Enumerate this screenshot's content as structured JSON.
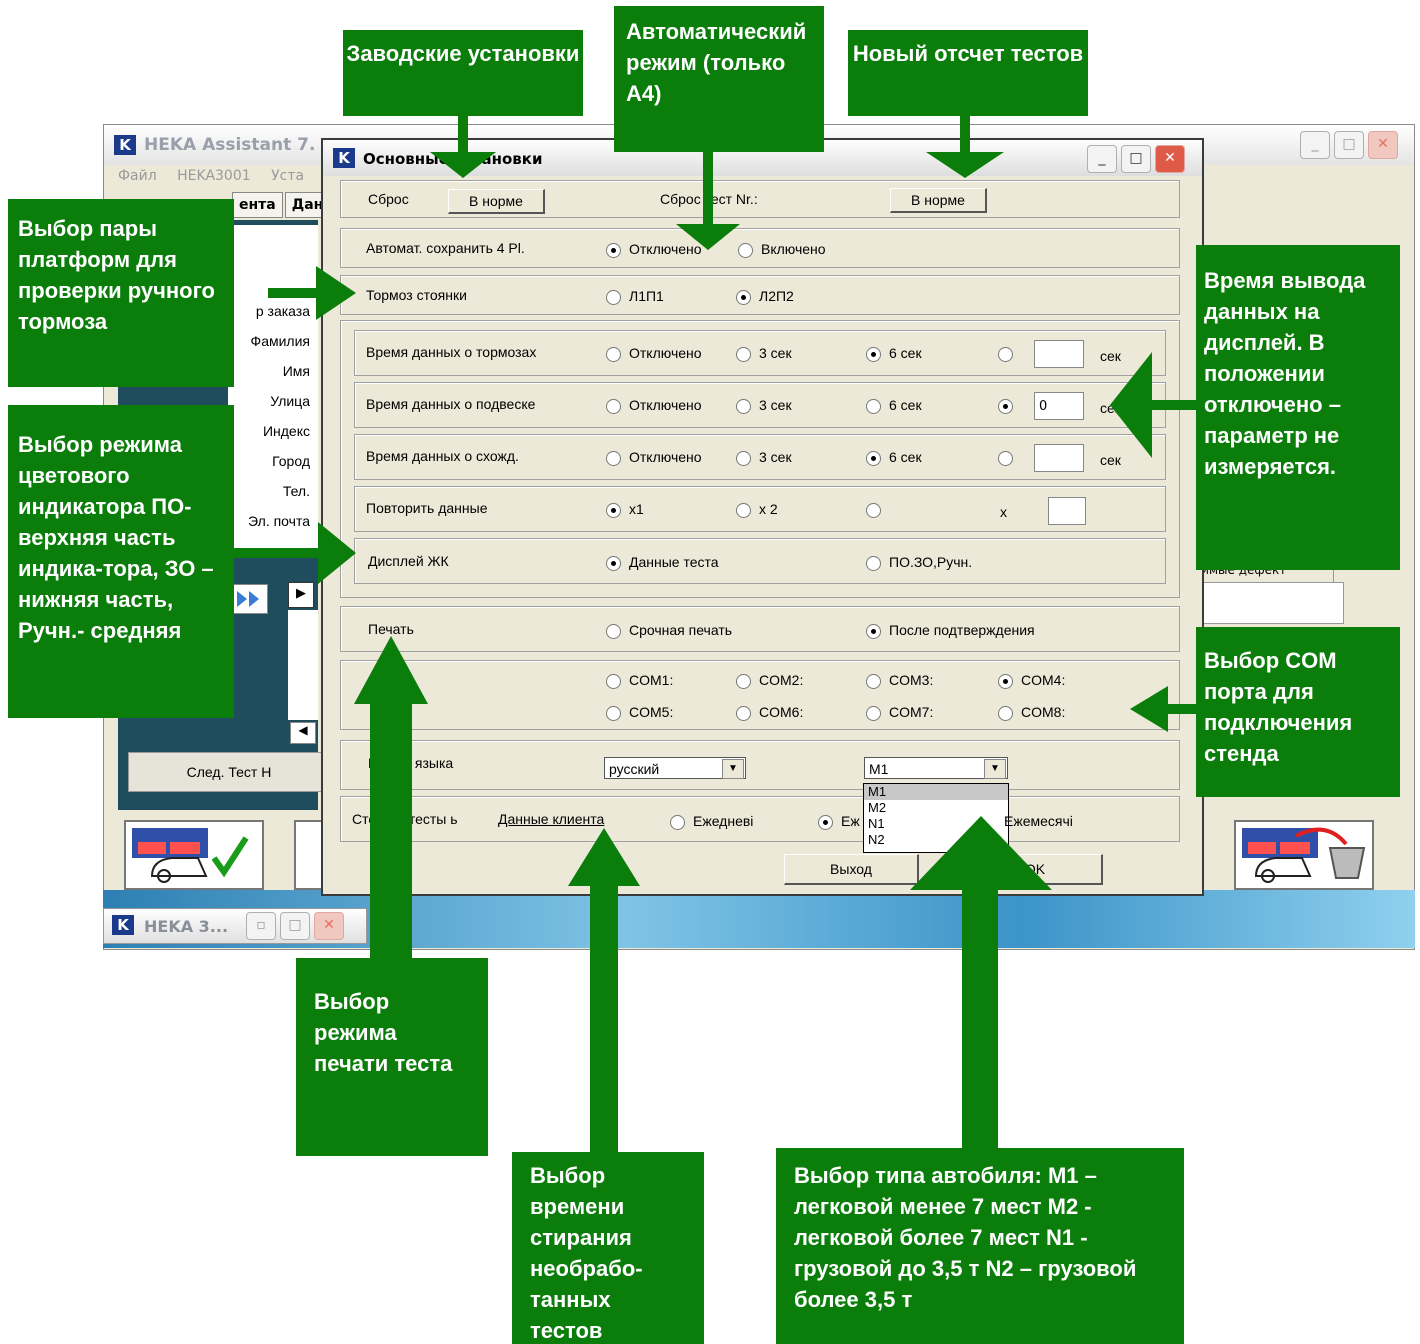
{
  "background_app": {
    "title": "HEKA Assistant 7.",
    "menu": [
      "Файл",
      "HEKA3001",
      "Уста"
    ],
    "tabs": [
      "ента",
      "Дан"
    ],
    "fields": [
      "р заказа",
      "Фамилия",
      "Имя",
      "Улица",
      "Индекс",
      "Город",
      "Тел.",
      "Эл. почта"
    ],
    "next_test_label": "След. Тест H",
    "right_tab_label": "цимые дефект",
    "minimized_title": "HEKA 3..."
  },
  "dialog": {
    "title": "Основные установки",
    "reset_label": "Сброс",
    "reset_button": "В норме",
    "reset_test_label": "Сброс тест Nr.:",
    "reset_test_button": "В норме",
    "autosave_label": "Автомат. сохранить 4 Pl.",
    "autosave_off": "Отключено",
    "autosave_on": "Включено",
    "parking_label": "Тормоз стоянки",
    "parking_opt1": "Л1П1",
    "parking_opt2": "Л2П2",
    "brakes_label": "Время данных о тормозах",
    "suspension_label": "Время данных о подвеске",
    "alignment_label": "Время данных о схожд.",
    "opt_off": "Отключено",
    "opt_3": "3 сек",
    "opt_6": "6 сек",
    "unit_sec": "сек",
    "suspension_value": "0",
    "repeat_label": "Повторить данные",
    "repeat_x1": "x1",
    "repeat_x2": "x 2",
    "repeat_x": "x",
    "lcd_label": "Дисплей ЖК",
    "lcd_opt1": "Данные теста",
    "lcd_opt2": "ПО.ЗО,Ручн.",
    "print_label": "Печать",
    "print_opt1": "Срочная печать",
    "print_opt2": "После подтверждения",
    "com_ports": [
      "COM1:",
      "COM2:",
      "COM3:",
      "COM4:",
      "COM5:",
      "COM6:",
      "COM7:",
      "COM8:"
    ],
    "language_label": "Выбор языка",
    "language_value": "русский",
    "vehicle_value": "M1",
    "vehicle_options": [
      "M1",
      "M2",
      "N1",
      "N2"
    ],
    "erase_label": "Стереть тесты ь",
    "erase_link": "Данные клиента",
    "erase_daily": "Ежедневі",
    "erase_weekly": "Еж",
    "erase_monthly": "Ежемесячі",
    "exit_button": "Выход",
    "ok_button": "OK"
  },
  "annotations": {
    "factory": "Заводские установки",
    "auto_mode": "Автоматический режим (только А4)",
    "new_count": "Новый отсчет тестов",
    "parking_pair": "Выбор пары платформ для проверки ручного тормоза",
    "display_time": "Время вывода данных на дисплей. В положении отключено – параметр не измеряется.",
    "color_indicator": "Выбор режима цветового индикатора ПО-верхняя часть индика-тора, ЗО – нижняя часть, Ручн.- средняя",
    "com_port": "Выбор COM порта для подключения стенда",
    "print_mode": "Выбор режима печати теста",
    "erase_time": "Выбор времени стирания необрабо-танных тестов",
    "vehicle_type": "Выбор типа автобиля: M1 – легковой менее 7 мест M2 - легковой более 7 мест N1 - грузовой до 3,5 т N2 – грузовой более 3,5 т"
  },
  "colors": {
    "annotation_green": "#0a7d0a",
    "dialog_bg": "#ece9d8",
    "close_red": "#e8705f"
  }
}
